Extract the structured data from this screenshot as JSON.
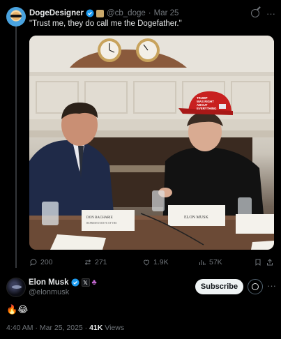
{
  "quoted": {
    "display_name": "DogeDesigner",
    "handle": "@cb_doge",
    "separator": "·",
    "date": "Mar 25",
    "text": "\"Trust me, they do call me the Dogefather.\"",
    "more": "···",
    "photo": {
      "placard_left_line1": "DON BACHARIE",
      "placard_left_line2": "REPRESENTATIVE OF THE",
      "placard_left_line3": "",
      "placard_center": "ELON MUSK",
      "placard_right_line1": "",
      "hat_text_line1": "TRUMP",
      "hat_text_line2": "WAS RIGHT",
      "hat_text_line3": "ABOUT",
      "hat_text_line4": "EVERYTHING"
    },
    "actions": {
      "replies": "200",
      "reposts": "271",
      "likes": "1.9K",
      "views": "57K"
    }
  },
  "post": {
    "display_name": "Elon Musk",
    "handle": "@elonmusk",
    "x_badge": "𝕏",
    "subscribe_label": "Subscribe",
    "more": "···",
    "text": "🔥😂",
    "time": "4:40 AM",
    "date": "Mar 25, 2025",
    "views_count": "41K",
    "views_label": "Views",
    "separator": "·"
  },
  "colors": {
    "background": "#000000",
    "text_primary": "#e7e9ea",
    "text_secondary": "#71767b",
    "verified_blue": "#1d9bf0",
    "subscribe_bg": "#eff3f4"
  },
  "icons": [
    "verified-icon",
    "grok-icon",
    "reply-icon",
    "repost-icon",
    "like-icon",
    "views-icon",
    "bookmark-icon",
    "share-icon"
  ]
}
